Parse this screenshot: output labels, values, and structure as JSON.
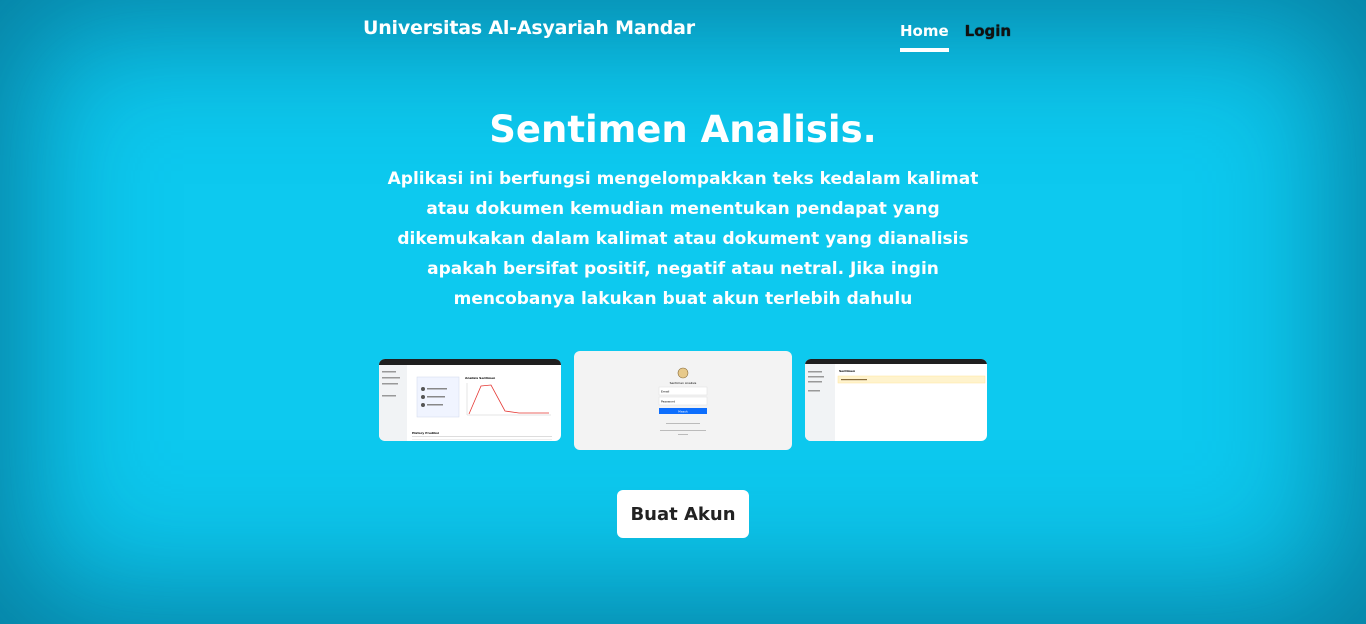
{
  "header": {
    "brand": "Universitas Al-Asyariah Mandar",
    "nav": [
      {
        "label": "Home"
      },
      {
        "label": "Login"
      }
    ]
  },
  "hero": {
    "title": "Sentimen Analisis.",
    "description": "Aplikasi ini berfungsi mengelompakkan teks kedalam kalimat atau dokumen kemudian menentukan pendapat yang dikemukakan dalam kalimat atau dokument yang dianalisis apakah bersifat positif, negatif atau netral. Jika ingin mencobanya lakukan buat akun terlebih dahulu"
  },
  "preview": {
    "dashboard": {
      "chart_title": "Analisis Sentimen",
      "history_title": "History Prediksi"
    },
    "login": {
      "app_title": "Sentimen Analisis",
      "email_placeholder": "Email",
      "password_placeholder": "Password",
      "submit_label": "Masuk"
    },
    "sentimen": {
      "page_title": "Sentimen"
    }
  },
  "cta": {
    "label": "Buat Akun"
  },
  "colors": {
    "background": "#0dc9ef",
    "text": "#ffffff",
    "accent": "#0d6efd"
  }
}
